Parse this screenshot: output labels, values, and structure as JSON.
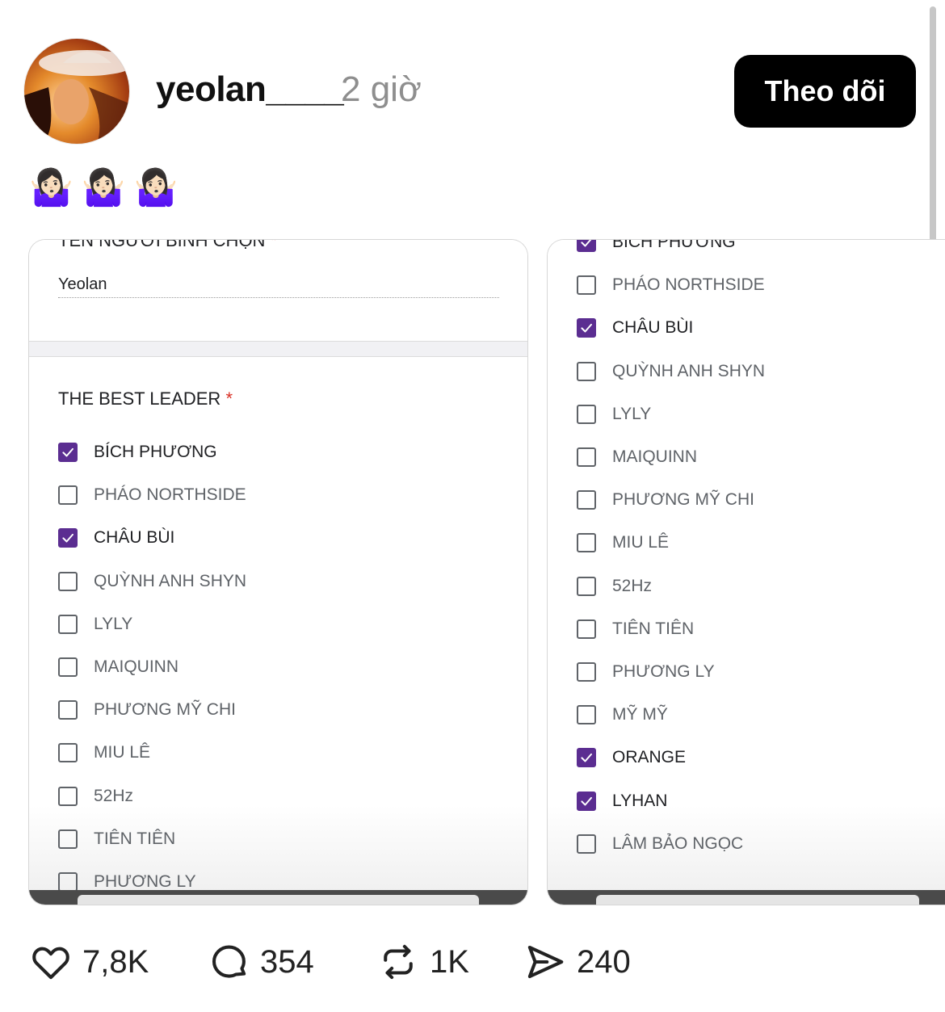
{
  "post": {
    "username": "yeolan____",
    "time": "2 giờ",
    "follow_label": "Theo dõi",
    "emojis": [
      "🤷🏻‍♀️",
      "🤷🏻‍♀️",
      "🤷🏻‍♀️"
    ]
  },
  "left_image": {
    "cut_title": "TÊN NGƯỜI BÌNH CHỌN",
    "required_mark": "*",
    "name_value": "Yeolan",
    "question_title": "THE BEST LEADER",
    "options": [
      {
        "label": "BÍCH PHƯƠNG",
        "checked": true
      },
      {
        "label": "PHÁO NORTHSIDE",
        "checked": false
      },
      {
        "label": "CHÂU BÙI",
        "checked": true
      },
      {
        "label": "QUỲNH ANH SHYN",
        "checked": false
      },
      {
        "label": "LYLY",
        "checked": false
      },
      {
        "label": "MAIQUINN",
        "checked": false
      },
      {
        "label": "PHƯƠNG MỸ CHI",
        "checked": false
      },
      {
        "label": "MIU LÊ",
        "checked": false
      },
      {
        "label": "52Hz",
        "checked": false
      },
      {
        "label": "TIÊN TIÊN",
        "checked": false
      },
      {
        "label": "PHƯƠNG LY",
        "checked": false
      }
    ]
  },
  "right_image": {
    "options": [
      {
        "label": "BÍCH PHƯƠNG",
        "checked": true
      },
      {
        "label": "PHÁO NORTHSIDE",
        "checked": false
      },
      {
        "label": "CHÂU BÙI",
        "checked": true
      },
      {
        "label": "QUỲNH ANH SHYN",
        "checked": false
      },
      {
        "label": "LYLY",
        "checked": false
      },
      {
        "label": "MAIQUINN",
        "checked": false
      },
      {
        "label": "PHƯƠNG MỸ CHI",
        "checked": false
      },
      {
        "label": "MIU LÊ",
        "checked": false
      },
      {
        "label": "52Hz",
        "checked": false
      },
      {
        "label": "TIÊN TIÊN",
        "checked": false
      },
      {
        "label": "PHƯƠNG LY",
        "checked": false
      },
      {
        "label": "MỸ MỸ",
        "checked": false
      },
      {
        "label": "ORANGE",
        "checked": true
      },
      {
        "label": "LYHAN",
        "checked": true
      },
      {
        "label": "LÂM BẢO NGỌC",
        "checked": false
      }
    ]
  },
  "actions": {
    "likes": "7,8K",
    "comments": "354",
    "reposts": "1K",
    "shares": "240"
  },
  "colors": {
    "checkbox_checked": "#5b2d91",
    "required_star": "#d93025",
    "follow_bg": "#000000",
    "time_gray": "#8e8e8e"
  },
  "icons": {
    "like": "heart-icon",
    "comment": "comment-bubble-icon",
    "repost": "repost-arrows-icon",
    "share": "send-icon"
  }
}
